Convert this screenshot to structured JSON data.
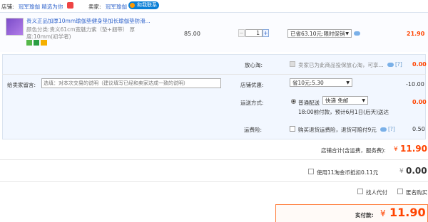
{
  "shop": {
    "shop_label": "店铺:",
    "shop_name": "冠军瑜伽 精选为你",
    "seller_label": "卖家:",
    "seller_name": "冠军瑜伽",
    "contact_label": "和我联系"
  },
  "item": {
    "title": "贵义正品加厚10mm瑜伽垫健身垫加长瑜伽垫防滑...",
    "attr_line1": "颜色分类:贵义61cm宽魅力紫（垫+捆带）  厚",
    "attr_line2": "度:10mm(初学者)",
    "price": "85.00",
    "qty": "1",
    "promo": "已省63.10元:限时促销",
    "subtotal": "21.90"
  },
  "service": {
    "label": "放心淘:",
    "text": "卖家已为此商品投保放心淘，可享...",
    "help": "[?]",
    "amount": "0.00"
  },
  "message": {
    "label": "给卖家留言:",
    "placeholder": "选填：对本次交易的说明（建议填写已经和卖家达成一致的说明）"
  },
  "discount": {
    "label": "店铺优惠:",
    "value": "省10元:5.30",
    "amount": "-10.00"
  },
  "shipping": {
    "label": "运送方式:",
    "method": "普通配送",
    "option": "快递 免邮",
    "note": "18:00前付款，预计6月1日(后天)送达",
    "amount": "0.00"
  },
  "insurance": {
    "label": "运费险:",
    "text": "购买退货运费险，退货可赔付9元",
    "help": "[?]",
    "amount": "0.50"
  },
  "shop_total": {
    "label": "店铺合计(含运费，服务费):",
    "currency": "¥",
    "value": "11.90"
  },
  "tmall_coin": {
    "text": "使用11淘金币抵扣0.11元",
    "currency": "¥",
    "value": "0.00"
  },
  "options": {
    "proxy_pay": "找人代付",
    "anonymous": "匿名购买"
  },
  "final": {
    "label": "实付款:",
    "currency": "¥",
    "value": "11.90"
  },
  "colors": {
    "accent": "#ff4400",
    "link": "#3366cc",
    "panel_bg": "#f2f7ff"
  }
}
